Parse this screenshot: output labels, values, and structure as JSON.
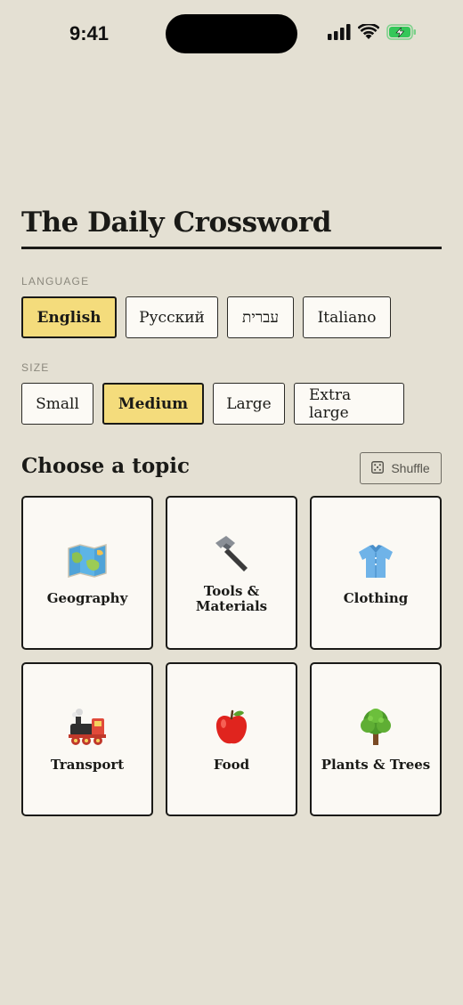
{
  "status_bar": {
    "time": "9:41"
  },
  "title": "The Daily Crossword",
  "language": {
    "label": "LANGUAGE",
    "options": [
      "English",
      "Русский",
      "עברית",
      "Italiano"
    ],
    "selected": "English"
  },
  "size": {
    "label": "SIZE",
    "options": [
      "Small",
      "Medium",
      "Large",
      "Extra large"
    ],
    "selected": "Medium"
  },
  "topics": {
    "heading": "Choose a topic",
    "shuffle_label": "Shuffle",
    "items": [
      {
        "label": "Geography",
        "icon": "map-icon"
      },
      {
        "label": "Tools &\nMaterials",
        "icon": "hammer-icon"
      },
      {
        "label": "Clothing",
        "icon": "shirt-icon"
      },
      {
        "label": "Transport",
        "icon": "train-icon"
      },
      {
        "label": "Food",
        "icon": "apple-icon"
      },
      {
        "label": "Plants & Trees",
        "icon": "tree-icon"
      }
    ]
  },
  "colors": {
    "background": "#e4e0d3",
    "selected": "#f4dc7c",
    "card": "#fbf9f4",
    "battery": "#34c759"
  }
}
